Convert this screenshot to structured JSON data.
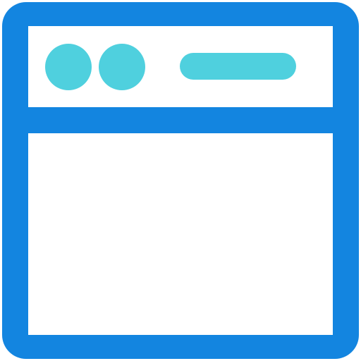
{
  "icon": {
    "name": "browser-window-icon",
    "colors": {
      "frame": "#1385e0",
      "accent": "#4fd0de",
      "background": "#ffffff"
    },
    "parts": {
      "window_controls": [
        "control-dot-1",
        "control-dot-2"
      ],
      "address_bar": "address-bar-pill"
    }
  }
}
